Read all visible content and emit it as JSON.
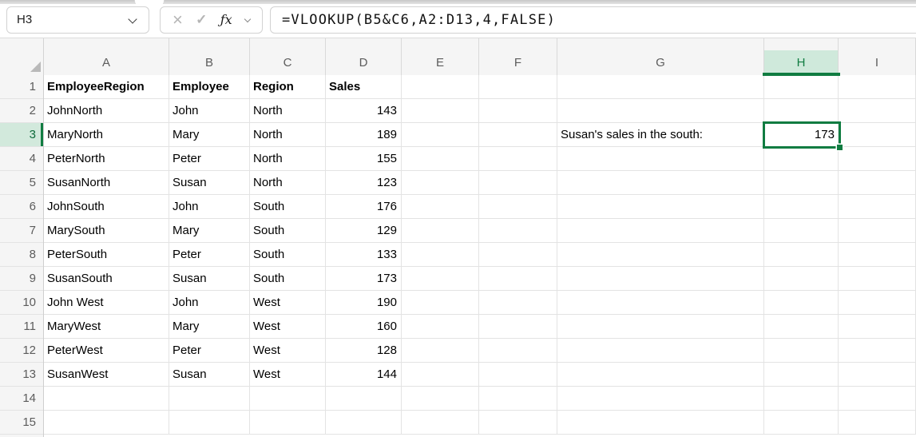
{
  "formula_bar": {
    "cell_reference": "H3",
    "formula": "=VLOOKUP(B5&C6,A2:D13,4,FALSE)",
    "icons": {
      "cancel": "×",
      "confirm": "✓",
      "insert_function": "ƒx"
    }
  },
  "selection": {
    "active_cell": "H3",
    "column": "H",
    "row": 3
  },
  "sheet": {
    "columns": [
      "A",
      "B",
      "C",
      "D",
      "E",
      "F",
      "G",
      "H",
      "I"
    ],
    "rows": [
      {
        "n": "1",
        "cells": [
          "EmployeeRegion",
          "Employee",
          "Region",
          "Sales"
        ],
        "bold": true
      },
      {
        "n": "2",
        "cells": [
          "JohnNorth",
          "John",
          "North",
          "143"
        ]
      },
      {
        "n": "3",
        "cells": [
          "MaryNorth",
          "Mary",
          "North",
          "189"
        ]
      },
      {
        "n": "4",
        "cells": [
          "PeterNorth",
          "Peter",
          "North",
          "155"
        ]
      },
      {
        "n": "5",
        "cells": [
          "SusanNorth",
          "Susan",
          "North",
          "123"
        ]
      },
      {
        "n": "6",
        "cells": [
          "JohnSouth",
          "John",
          "South",
          "176"
        ]
      },
      {
        "n": "7",
        "cells": [
          "MarySouth",
          "Mary",
          "South",
          "129"
        ]
      },
      {
        "n": "8",
        "cells": [
          "PeterSouth",
          "Peter",
          "South",
          "133"
        ]
      },
      {
        "n": "9",
        "cells": [
          "SusanSouth",
          "Susan",
          "South",
          "173"
        ]
      },
      {
        "n": "10",
        "cells": [
          "John West",
          "John",
          "West",
          "190"
        ]
      },
      {
        "n": "11",
        "cells": [
          "MaryWest",
          "Mary",
          "West",
          "160"
        ]
      },
      {
        "n": "12",
        "cells": [
          "PeterWest",
          "Peter",
          "West",
          "128"
        ]
      },
      {
        "n": "13",
        "cells": [
          "SusanWest",
          "Susan",
          "West",
          "144"
        ]
      },
      {
        "n": "14",
        "cells": []
      },
      {
        "n": "15",
        "cells": []
      }
    ],
    "annotation": {
      "cell": "G3",
      "text": "Susan's sales in the south:"
    },
    "result": {
      "cell": "H3",
      "value": "173"
    }
  },
  "colors": {
    "accent_green": "#107C41",
    "selection_fill": "#D2E9DC",
    "header_bg": "#F5F5F5",
    "gridline": "#E3E3E3"
  }
}
